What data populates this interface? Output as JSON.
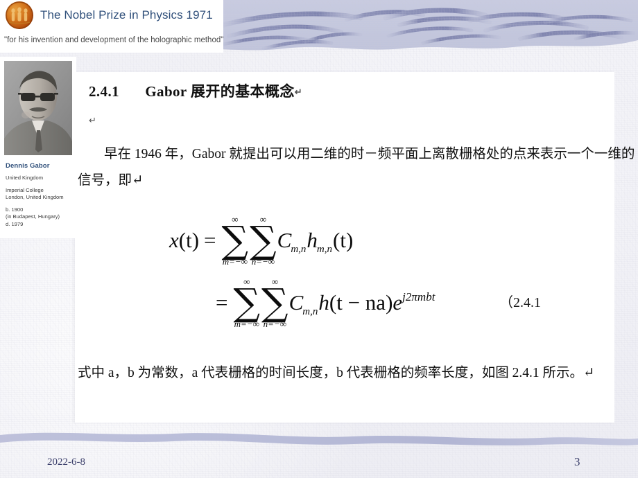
{
  "nobel_header": {
    "medal_icon": "nobel-medal-icon",
    "title": "The Nobel Prize in Physics 1971",
    "citation": "\"for his invention and development of the holographic method\"",
    "title_color": "#2f4f7a"
  },
  "laureate": {
    "portrait_icon": "laureate-portrait-photo",
    "name": "Dennis Gabor",
    "country": "United Kingdom",
    "affiliation_line1": "Imperial College",
    "affiliation_line2": "London, United Kingdom",
    "born": "b. 1900",
    "born_place": "(in Budapest, Hungary)",
    "died": "d. 1979"
  },
  "content": {
    "heading_number": "2.4.1",
    "heading_text": "Gabor 展开的基本概念",
    "heading_return_mark": "↵",
    "empty_line_mark": "↵",
    "paragraph_top": "早在 1946 年，Gabor 就提出可以用二维的时－频平面上离散栅格处的点来表示一个一维的信号，即↵",
    "paragraph_bottom": "式中 a，b 为常数，a 代表栅格的时间长度，b 代表栅格的频率长度，如图 2.4.1 所示。↵"
  },
  "equation": {
    "line1": {
      "lhs_var": "x",
      "lhs_arg": "(t)",
      "relation": "=",
      "sum1_top": "∞",
      "sum1_bottom": "m=−∞",
      "sum2_top": "∞",
      "sum2_bottom": "n=−∞",
      "coef_base": "C",
      "coef_sub": "m,n",
      "fn_base": "h",
      "fn_sub": "m,n",
      "fn_arg": "(t)"
    },
    "line2": {
      "relation": "=",
      "sum1_top": "∞",
      "sum1_bottom": "m=−∞",
      "sum2_top": "∞",
      "sum2_bottom": "n=−∞",
      "coef_base": "C",
      "coef_sub": "m,n",
      "fn_base": "h",
      "fn_arg": "(t − na)",
      "exp_base": "e",
      "exp_sup": "j2πmbt"
    },
    "number": "（2.4.1"
  },
  "footer": {
    "date": "2022-6-8",
    "page_number": "3"
  },
  "theme": {
    "band_color": "#c4c7dd",
    "stroke_color": "#8e92b8",
    "paper_color": "#f1f1f6",
    "panel_color": "#ffffff",
    "footer_text_color": "#3b3f6b"
  }
}
